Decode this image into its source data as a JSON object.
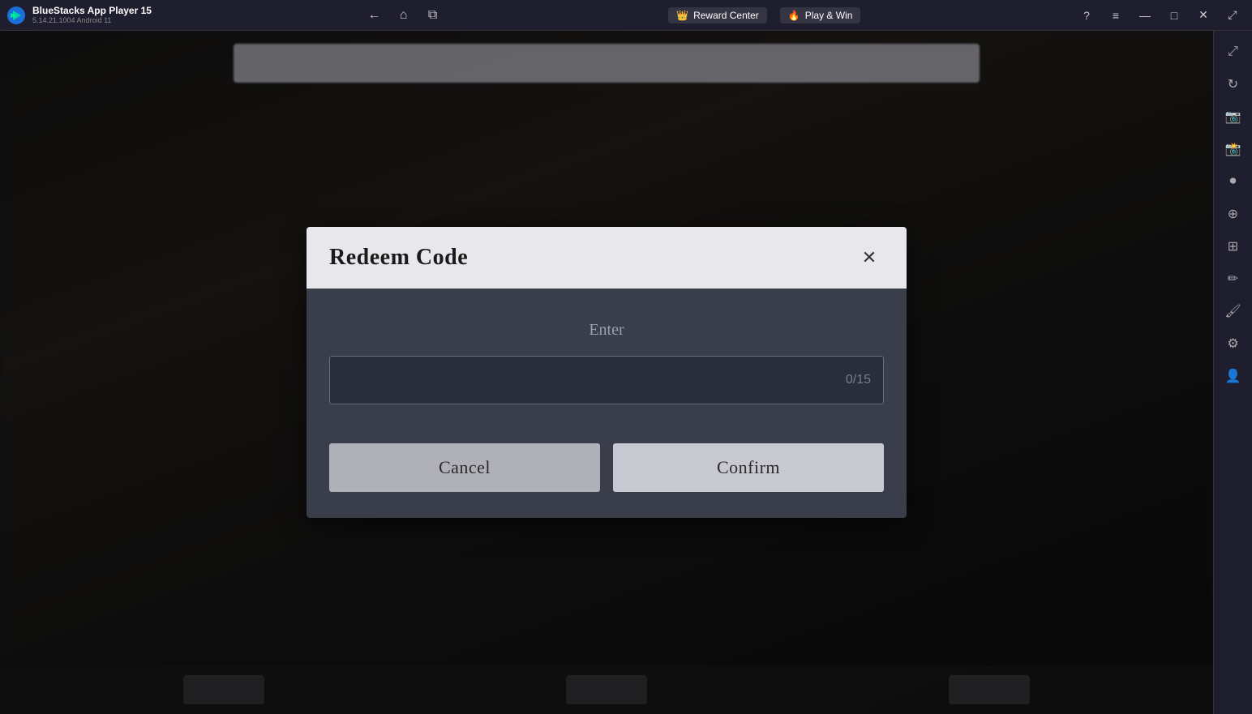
{
  "app": {
    "name": "BlueStacks App Player 15",
    "version": "5.14.21.1004  Android 11"
  },
  "titlebar": {
    "reward_center": "Reward Center",
    "play_win": "Play & Win",
    "nav": {
      "back": "←",
      "home": "⌂",
      "copy": "⧉"
    },
    "actions": {
      "help": "?",
      "menu": "≡",
      "minimize": "—",
      "maximize": "□",
      "close": "✕",
      "expand": "⤢"
    }
  },
  "sidebar": {
    "icons": [
      {
        "name": "expand-icon",
        "symbol": "⤢"
      },
      {
        "name": "rotate-icon",
        "symbol": "↻"
      },
      {
        "name": "camera-icon",
        "symbol": "📷"
      },
      {
        "name": "screenshot-icon",
        "symbol": "📸"
      },
      {
        "name": "record-icon",
        "symbol": "⏺"
      },
      {
        "name": "zoom-icon",
        "symbol": "⊕"
      },
      {
        "name": "layers-icon",
        "symbol": "⊞"
      },
      {
        "name": "edit-icon",
        "symbol": "✏"
      },
      {
        "name": "brush-icon",
        "symbol": "🖌"
      },
      {
        "name": "settings-icon",
        "symbol": "⚙"
      },
      {
        "name": "profile-icon",
        "symbol": "👤"
      }
    ]
  },
  "modal": {
    "title": "Redeem Code",
    "close_label": "✕",
    "enter_label": "Enter",
    "input_placeholder": "",
    "input_counter": "0/15",
    "cancel_button": "Cancel",
    "confirm_button": "Confirm"
  },
  "bottom_buttons": [
    {
      "label": ""
    },
    {
      "label": ""
    },
    {
      "label": ""
    }
  ]
}
